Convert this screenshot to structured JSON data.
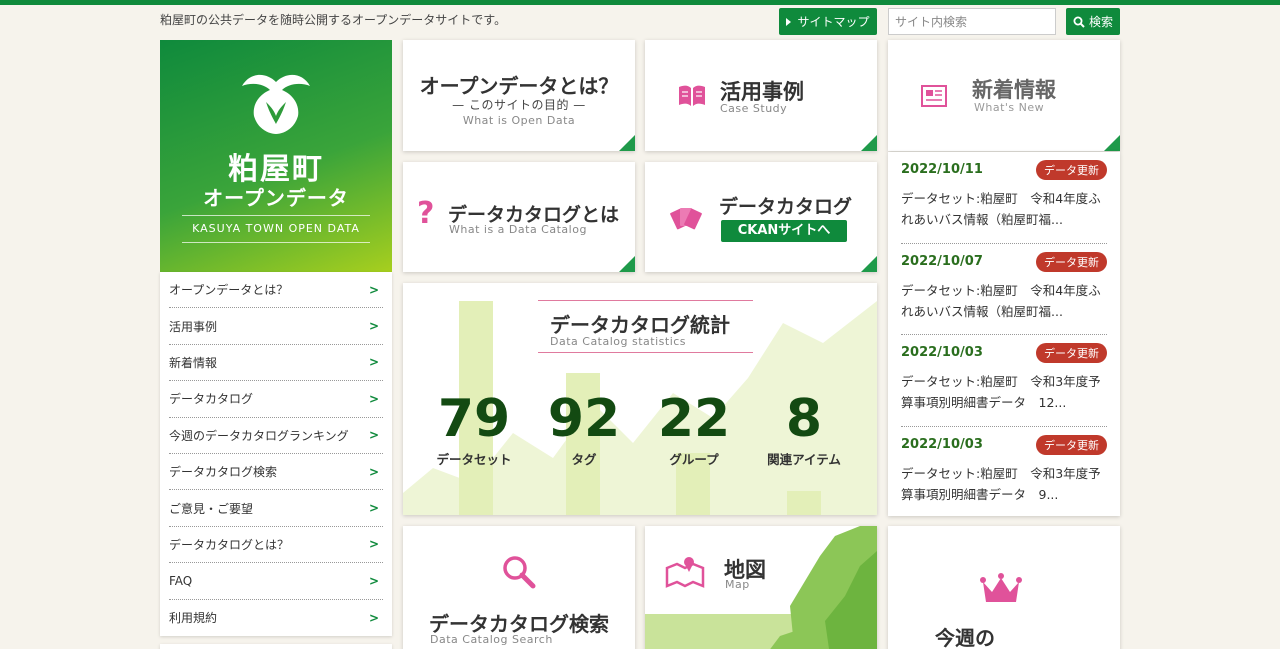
{
  "header": {
    "tagline": "粕屋町の公共データを随時公開するオープンデータサイトです。",
    "sitemap_label": "サイトマップ",
    "search_placeholder": "サイト内検索",
    "search_label": "検索"
  },
  "logo": {
    "name": "粕屋町",
    "subtitle": "オープンデータ",
    "english": "KASUYA TOWN OPEN DATA"
  },
  "menu": {
    "items": [
      {
        "label": "オープンデータとは？"
      },
      {
        "label": "活用事例"
      },
      {
        "label": "新着情報"
      },
      {
        "label": "データカタログ"
      },
      {
        "label": "今週のデータカタログランキング"
      },
      {
        "label": "データカタログ検索"
      },
      {
        "label": "ご意見・ご要望"
      },
      {
        "label": "データカタログとは？"
      },
      {
        "label": "FAQ"
      },
      {
        "label": "利用規約"
      }
    ]
  },
  "tiles": {
    "opendata": {
      "title": "オープンデータとは？",
      "sub1": "— このサイトの目的 —",
      "sub2": "What is Open Data"
    },
    "casestudy": {
      "title": "活用事例",
      "sub": "Case Study"
    },
    "news": {
      "title": "新着情報",
      "sub": "What's New"
    },
    "catalog_about": {
      "title": "データカタログとは",
      "sub": "What is a Data Catalog"
    },
    "catalog": {
      "title": "データカタログ",
      "button": "CKANサイトへ"
    },
    "search": {
      "title": "データカタログ検索",
      "sub": "Data Catalog Search"
    },
    "map": {
      "title": "地図",
      "sub": "Map"
    },
    "ranking": {
      "title": "今週の"
    }
  },
  "stats": {
    "title": "データカタログ統計",
    "sub": "Data Catalog statistics",
    "items": [
      {
        "value": "79",
        "label": "データセット"
      },
      {
        "value": "92",
        "label": "タグ"
      },
      {
        "value": "22",
        "label": "グループ"
      },
      {
        "value": "8",
        "label": "関連アイテム"
      }
    ]
  },
  "news": {
    "items": [
      {
        "date": "2022/10/11",
        "badge": "データ更新",
        "text": "データセット:粕屋町　令和4年度ふれあいバス情報（粕屋町福..."
      },
      {
        "date": "2022/10/07",
        "badge": "データ更新",
        "text": "データセット:粕屋町　令和4年度ふれあいバス情報（粕屋町福..."
      },
      {
        "date": "2022/10/03",
        "badge": "データ更新",
        "text": "データセット:粕屋町　令和3年度予算事項別明細書データ　12..."
      },
      {
        "date": "2022/10/03",
        "badge": "データ更新",
        "text": "データセット:粕屋町　令和3年度予算事項別明細書データ　9..."
      }
    ]
  },
  "colors": {
    "brand_green": "#0f8a3c",
    "accent_pink": "#e0529a",
    "badge_red": "#c0392b",
    "stat_green": "#134a12"
  }
}
